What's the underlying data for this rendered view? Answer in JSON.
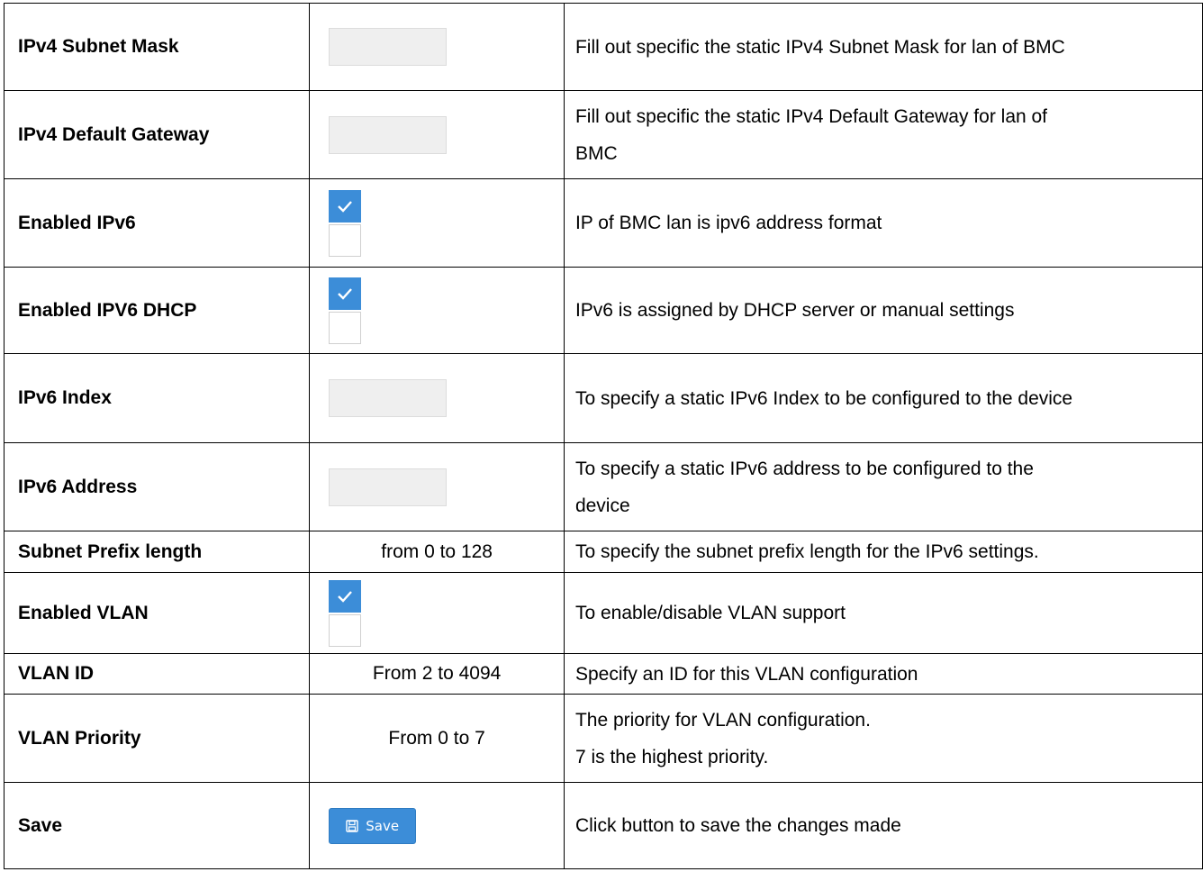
{
  "rows": [
    {
      "label": "IPv4 Subnet Mask",
      "desc": "Fill out specific the static IPv4 Subnet Mask for lan of BMC"
    },
    {
      "label": "IPv4 Default Gateway",
      "desc1": "Fill out specific the static IPv4 Default Gateway for lan of",
      "desc2": "BMC"
    },
    {
      "label": "Enabled IPv6",
      "desc": "IP of BMC lan is ipv6 address format"
    },
    {
      "label": "Enabled IPV6 DHCP",
      "desc": "IPv6 is assigned by DHCP server or manual settings"
    },
    {
      "label": "IPv6 Index",
      "desc": "To specify a static IPv6 Index to be configured to the device"
    },
    {
      "label": "IPv6 Address",
      "desc1": "To specify a static IPv6 address to be configured to the",
      "desc2": "device"
    },
    {
      "label": "Subnet Prefix length",
      "value": "from 0 to 128",
      "desc": "To specify the subnet prefix length for the IPv6 settings."
    },
    {
      "label": "Enabled VLAN",
      "desc": "To enable/disable VLAN support"
    },
    {
      "label": "VLAN ID",
      "value": "From 2 to 4094",
      "desc": "Specify an ID for this VLAN configuration"
    },
    {
      "label": "VLAN Priority",
      "value": "From 0 to 7",
      "desc1": "The priority for VLAN configuration.",
      "desc2": "7 is the highest priority."
    },
    {
      "label": "Save",
      "button": "Save",
      "desc": "Click button to save the changes made"
    }
  ],
  "icons": {
    "check": "check-icon",
    "save": "floppy-disk-icon"
  },
  "colors": {
    "accent": "#3c8dd8",
    "field_bg": "#efefef"
  }
}
